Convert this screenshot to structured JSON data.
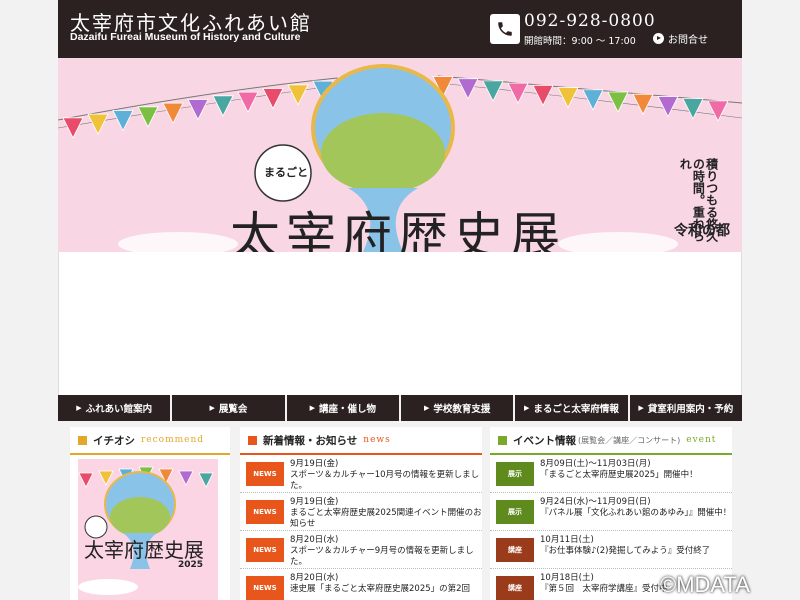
{
  "header": {
    "title": "太宰府市文化ふれあい館",
    "subtitle": "Dazaifu Fureai Museum of History and Culture",
    "phone": "092-928-0800",
    "hours": "開館時間：9:00 〜 17:00",
    "contact_label": "お問合せ"
  },
  "hero": {
    "side_text": "積りつもる悠久の時間。重ねられ",
    "era_text": "令和の都　だ",
    "title": "太宰府歴史展"
  },
  "nav": {
    "items": [
      {
        "label": "ふれあい館案内"
      },
      {
        "label": "展覧会"
      },
      {
        "label": "講座・催し物"
      },
      {
        "label": "学校教育支援"
      },
      {
        "label": "まるごと太宰府情報"
      },
      {
        "label": "貸室利用案内・予約"
      }
    ]
  },
  "recommend": {
    "title": "イチオシ",
    "title_en": "recommend",
    "accent": "#e3a72a",
    "poster_title": "太宰府歴史展",
    "poster_year": "2025"
  },
  "news": {
    "title": "新着情報・お知らせ",
    "title_en": "news",
    "accent": "#e8561b",
    "items": [
      {
        "badge": "NEWS",
        "date": "9月19日(金)",
        "text": "スポーツ＆カルチャー10月号の情報を更新しました。"
      },
      {
        "badge": "NEWS",
        "date": "9月19日(金)",
        "text": "まるごと太宰府歴史展2025関連イベント開催のお知らせ"
      },
      {
        "badge": "NEWS",
        "date": "8月20日(水)",
        "text": "スポーツ＆カルチャー9月号の情報を更新しました。"
      },
      {
        "badge": "NEWS",
        "date": "8月20日(水)",
        "text": "速史展「まるごと太宰府歴史展2025」の第2回"
      }
    ]
  },
  "events": {
    "title": "イベント情報",
    "title_sub": "(展覧会／講座／コンサート)",
    "title_en": "event",
    "accent": "#7aa82a",
    "items": [
      {
        "badge": "展示",
        "badge_color": "#5e8a1e",
        "date": "8月09日(土)〜11月03日(月)",
        "text": "「まるごと太宰府歴史展2025」開催中！"
      },
      {
        "badge": "展示",
        "badge_color": "#5e8a1e",
        "date": "9月24日(水)〜11月09日(日)",
        "text": "『パネル展「文化ふれあい館のあゆみ」』開催中！"
      },
      {
        "badge": "講座",
        "badge_color": "#9a3b1b",
        "date": "10月11日(土)",
        "text": "『お仕事体験♪(2)発掘してみよう』受付終了"
      },
      {
        "badge": "講座",
        "badge_color": "#9a3b1b",
        "date": "10月18日(土)",
        "text": "『第５回　太宰府学講座』受付中"
      }
    ]
  },
  "watermark": "©MDATA"
}
